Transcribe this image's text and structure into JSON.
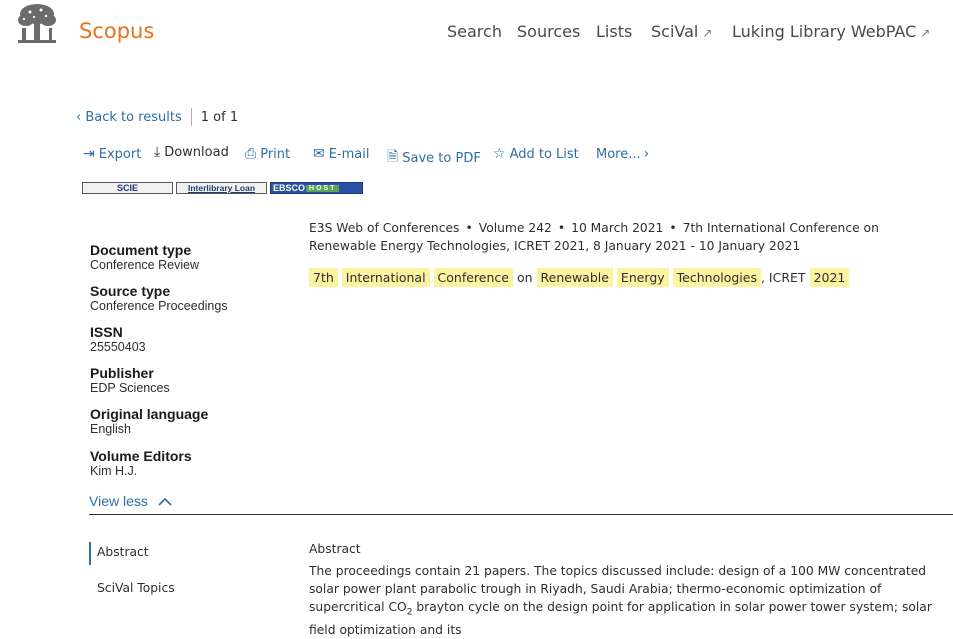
{
  "header": {
    "brand": "Scopus",
    "nav": [
      "Search",
      "Sources",
      "Lists",
      "SciVal",
      "Luking Library WebPAC"
    ],
    "external_marker": "↗"
  },
  "backbar": {
    "back_label": "Back to results",
    "position": "1 of 1"
  },
  "toolbar": {
    "export": "Export",
    "download": "Download",
    "print": "Print",
    "email": "E-mail",
    "save_pdf": "Save to PDF",
    "add_list": "Add to List",
    "more": "More..."
  },
  "badges": {
    "scie": "SCIE",
    "ill": "Interlibrary Loan",
    "ebsco": "EBSCO",
    "host": "HOST"
  },
  "citation": {
    "source": "E3S Web of Conferences",
    "volume": "Volume 242",
    "date": "10 March 2021",
    "conference": "7th International Conference on Renewable Energy Technologies, ICRET 2021, 8 January 2021 - 10 January 2021"
  },
  "title": {
    "w1": "7th",
    "w2": "International",
    "w3": "Conference",
    "w4": "on",
    "w5": "Renewable",
    "w6": "Energy",
    "w7": "Technologies",
    "w8": ", ICRET",
    "w9": "2021"
  },
  "meta": {
    "doc_type_label": "Document type",
    "doc_type": "Conference Review",
    "source_type_label": "Source type",
    "source_type": "Conference Proceedings",
    "issn_label": "ISSN",
    "issn": "25550403",
    "publisher_label": "Publisher",
    "publisher": "EDP Sciences",
    "language_label": "Original language",
    "language": "English",
    "editors_label": "Volume Editors",
    "editors": "Kim H.J."
  },
  "view_less": "View less",
  "sidenav": {
    "abstract": "Abstract",
    "scival": "SciVal Topics"
  },
  "abstract": {
    "heading": "Abstract",
    "body_part1": "The proceedings contain 21 papers. The topics discussed include: design of a 100 MW concentrated solar power plant parabolic trough in Riyadh, Saudi Arabia; thermo-economic optimization of supercritical CO",
    "sub": "2",
    "body_part2": " brayton cycle on the design point for application in solar power tower system; solar field optimization and its"
  },
  "colors": {
    "brand": "#e9711c",
    "link": "#2e6ea6",
    "highlight": "#fbf3a0"
  }
}
